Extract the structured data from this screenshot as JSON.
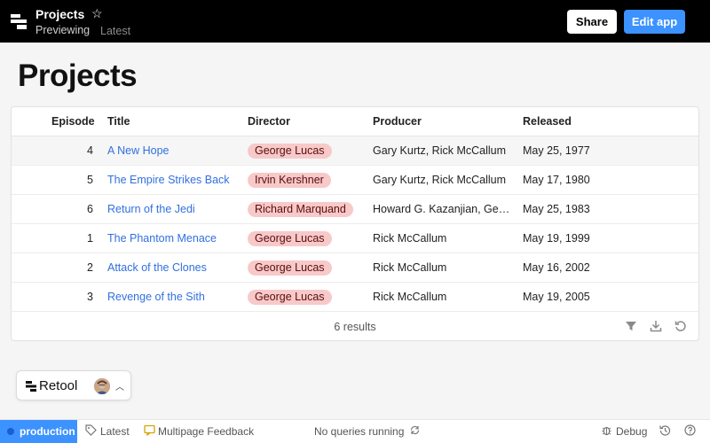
{
  "header": {
    "app_title": "Projects",
    "previewing": "Previewing",
    "version": "Latest",
    "share_label": "Share",
    "edit_label": "Edit app"
  },
  "page": {
    "title": "Projects"
  },
  "table": {
    "columns": [
      "Episode",
      "Title",
      "Director",
      "Producer",
      "Released"
    ],
    "rows": [
      {
        "episode": "4",
        "title": "A New Hope",
        "director": "George Lucas",
        "producer": "Gary Kurtz, Rick McCallum",
        "released": "May 25, 1977"
      },
      {
        "episode": "5",
        "title": "The Empire Strikes Back",
        "director": "Irvin Kershner",
        "producer": "Gary Kurtz, Rick McCallum",
        "released": "May 17, 1980"
      },
      {
        "episode": "6",
        "title": "Return of the Jedi",
        "director": "Richard Marquand",
        "producer": "Howard G. Kazanjian, Ge…",
        "released": "May 25, 1983"
      },
      {
        "episode": "1",
        "title": "The Phantom Menace",
        "director": "George Lucas",
        "producer": "Rick McCallum",
        "released": "May 19, 1999"
      },
      {
        "episode": "2",
        "title": "Attack of the Clones",
        "director": "George Lucas",
        "producer": "Rick McCallum",
        "released": "May 16, 2002"
      },
      {
        "episode": "3",
        "title": "Revenge of the Sith",
        "director": "George Lucas",
        "producer": "Rick McCallum",
        "released": "May 19, 2005"
      }
    ],
    "results_text": "6 results",
    "icons": [
      "filter-icon",
      "download-icon",
      "refresh-icon"
    ]
  },
  "widget": {
    "brand": "Retool"
  },
  "statusbar": {
    "environment": "production",
    "version": "Latest",
    "feedback": "Multipage Feedback",
    "queries": "No queries running",
    "debug": "Debug"
  },
  "colors": {
    "accent": "#3c92ff",
    "link": "#3170e0",
    "tag_bg": "#f8c9c9",
    "tag_text": "#5a0d0d"
  }
}
